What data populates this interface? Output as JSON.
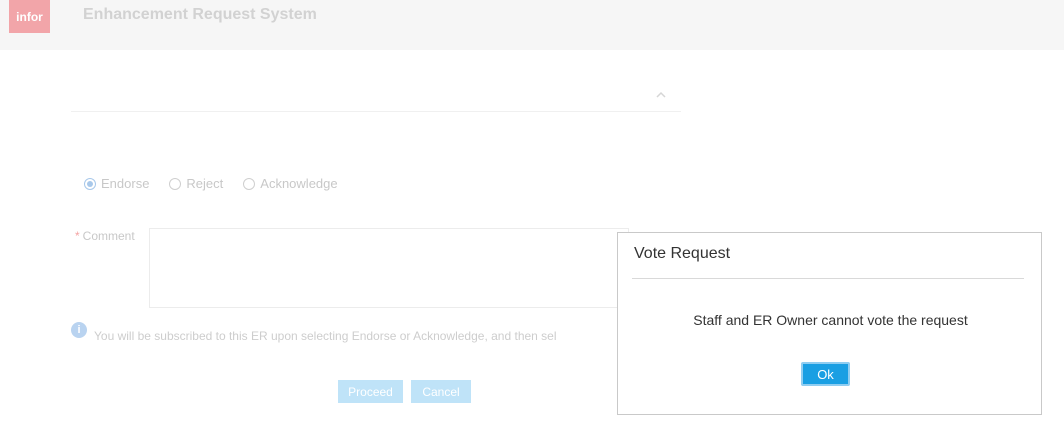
{
  "header": {
    "logo_text": "infor",
    "app_title": "Enhancement Request System"
  },
  "form": {
    "radios": [
      {
        "label": "Endorse",
        "checked": true
      },
      {
        "label": "Reject",
        "checked": false
      },
      {
        "label": "Acknowledge",
        "checked": false
      }
    ],
    "comment_required_mark": "*",
    "comment_label": "Comment",
    "comment_value": "",
    "info_text": "You will be subscribed to this ER upon selecting Endorse or Acknowledge, and then sel",
    "proceed_label": "Proceed",
    "cancel_label": "Cancel"
  },
  "dialog": {
    "title": "Vote Request",
    "message": "Staff and ER Owner cannot vote the request",
    "ok_label": "Ok"
  },
  "colors": {
    "dialog_button": "#1a9fe3",
    "logo": "#f2a5a9"
  }
}
